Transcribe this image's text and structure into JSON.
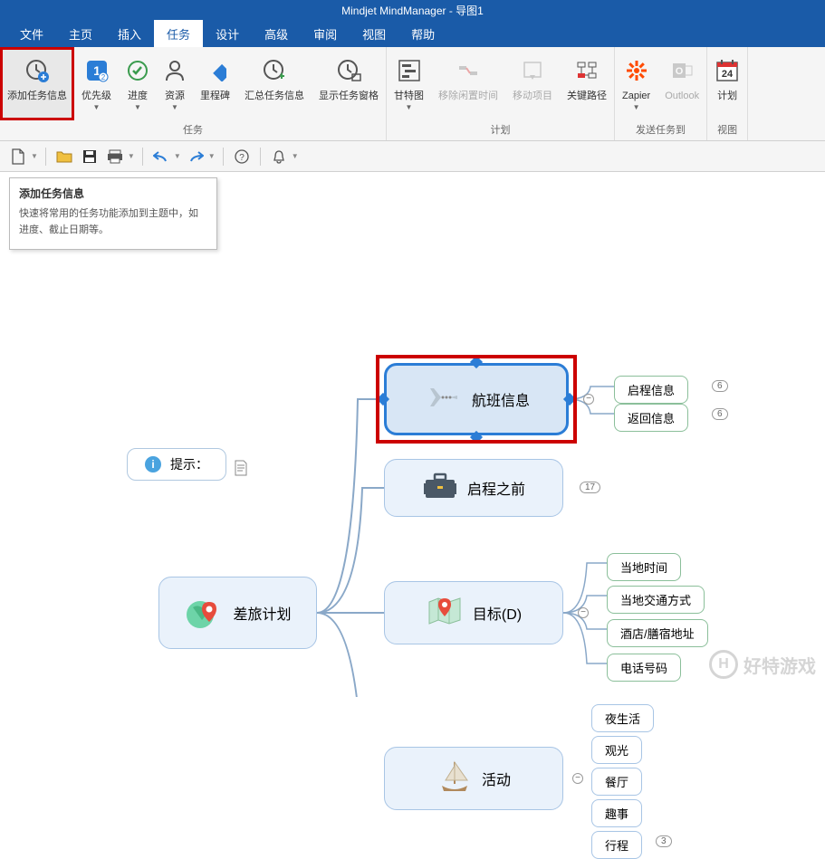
{
  "title": "Mindjet MindManager - 导图1",
  "menu": {
    "items": [
      "文件",
      "主页",
      "插入",
      "任务",
      "设计",
      "高级",
      "审阅",
      "视图",
      "帮助"
    ],
    "active_index": 3
  },
  "ribbon": {
    "buttons": {
      "add_task": "添加任务信息",
      "priority": "优先级",
      "progress": "进度",
      "resource": "资源",
      "milestone": "里程碑",
      "summary": "汇总任务信息",
      "show_panel": "显示任务窗格",
      "gantt": "甘特图",
      "remove_idle": "移除闲置时间",
      "move_project": "移动项目",
      "critical_path": "关键路径",
      "zapier": "Zapier",
      "outlook": "Outlook",
      "plan": "计划"
    },
    "groups": {
      "tasks": "任务",
      "plan": "计划",
      "send_to": "发送任务到",
      "view": "视图"
    }
  },
  "tooltip": {
    "title": "添加任务信息",
    "body": "快速将常用的任务功能添加到主题中，如进度、截止日期等。"
  },
  "nodes": {
    "root": "差旅计划",
    "tip": "提示：",
    "flight": "航班信息",
    "flight_children": {
      "depart": "启程信息",
      "return": "返回信息"
    },
    "flight_badges": {
      "depart": "6",
      "return": "6"
    },
    "before": "启程之前",
    "before_badge": "17",
    "target": "目标(D)",
    "target_children": {
      "localtime": "当地时间",
      "transport": "当地交通方式",
      "hotel": "酒店/膳宿地址",
      "phone": "电话号码"
    },
    "activity": "活动",
    "activity_children": {
      "nightlife": "夜生活",
      "sightseeing": "观光",
      "restaurant": "餐厅",
      "fun": "趣事",
      "itinerary": "行程"
    },
    "activity_badge": "3"
  },
  "watermark": "好特游戏",
  "plan_day": "24"
}
